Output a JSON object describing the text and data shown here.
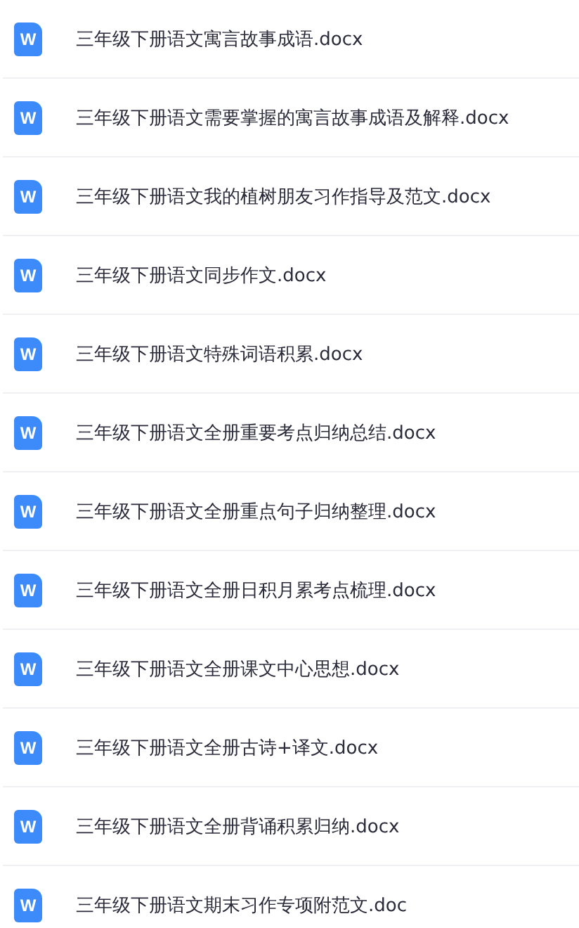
{
  "files": [
    {
      "icon": "W",
      "name": "三年级下册语文寓言故事成语.docx"
    },
    {
      "icon": "W",
      "name": "三年级下册语文需要掌握的寓言故事成语及解释.docx"
    },
    {
      "icon": "W",
      "name": "三年级下册语文我的植树朋友习作指导及范文.docx"
    },
    {
      "icon": "W",
      "name": "三年级下册语文同步作文.docx"
    },
    {
      "icon": "W",
      "name": "三年级下册语文特殊词语积累.docx"
    },
    {
      "icon": "W",
      "name": "三年级下册语文全册重要考点归纳总结.docx"
    },
    {
      "icon": "W",
      "name": "三年级下册语文全册重点句子归纳整理.docx"
    },
    {
      "icon": "W",
      "name": "三年级下册语文全册日积月累考点梳理.docx"
    },
    {
      "icon": "W",
      "name": "三年级下册语文全册课文中心思想.docx"
    },
    {
      "icon": "W",
      "name": "三年级下册语文全册古诗+译文.docx"
    },
    {
      "icon": "W",
      "name": "三年级下册语文全册背诵积累归纳.docx"
    },
    {
      "icon": "W",
      "name": "三年级下册语文期末习作专项附范文.doc"
    }
  ]
}
